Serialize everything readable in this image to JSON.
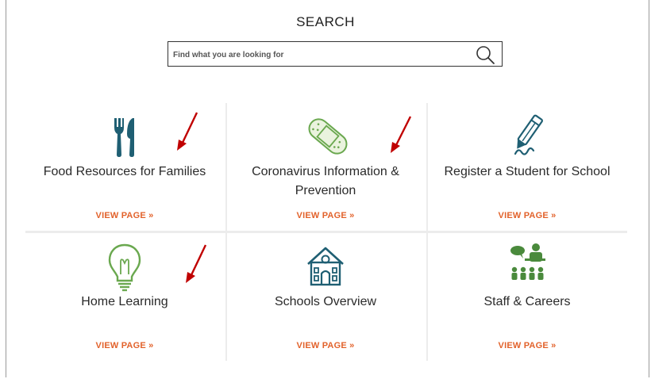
{
  "search": {
    "title": "SEARCH",
    "placeholder": "Find what you are looking for"
  },
  "tiles": [
    {
      "title": "Food Resources for Families",
      "link": "VIEW PAGE »",
      "icon": "fork-knife-icon"
    },
    {
      "title": "Coronavirus Information & Prevention",
      "link": "VIEW PAGE »",
      "icon": "bandage-icon"
    },
    {
      "title": "Register a Student for School",
      "link": "VIEW PAGE »",
      "icon": "pencil-icon"
    },
    {
      "title": "Home Learning",
      "link": "VIEW PAGE »",
      "icon": "lightbulb-icon"
    },
    {
      "title": "Schools Overview",
      "link": "VIEW PAGE »",
      "icon": "school-building-icon"
    },
    {
      "title": "Staff & Careers",
      "link": "VIEW PAGE »",
      "icon": "staff-group-icon"
    }
  ],
  "colors": {
    "link": "#e2622b",
    "icon_teal": "#1f5f73",
    "icon_green": "#4a8a3c",
    "annotation_arrow": "#c00000"
  }
}
